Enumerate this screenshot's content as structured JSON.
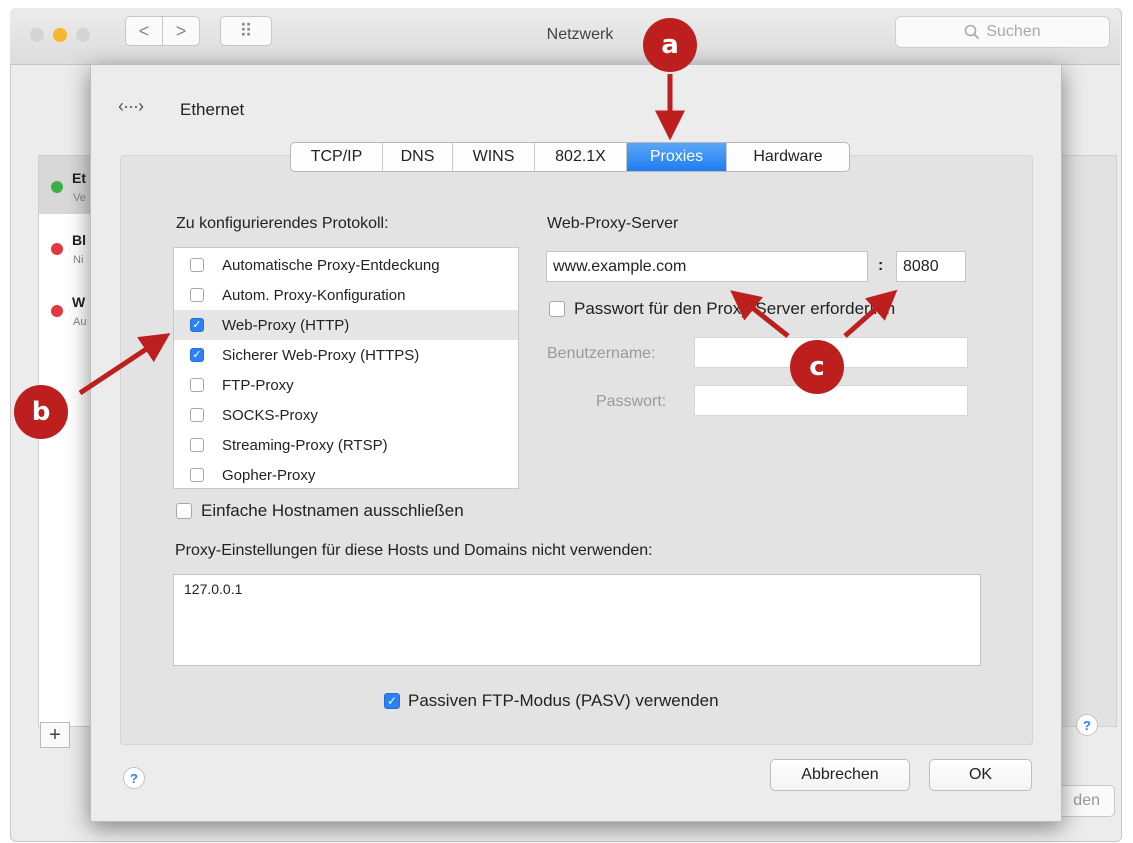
{
  "window": {
    "title": "Netzwerk",
    "search_placeholder": "Suchen",
    "back_glyph": "<",
    "forward_glyph": ">",
    "grid_glyph": "⠿",
    "traffic_lights": {
      "close": "#d4d4d4",
      "minimize": "#f5b82e",
      "zoom": "#d4d4d4"
    }
  },
  "background": {
    "services": [
      {
        "name": "Et",
        "sub": "Ve",
        "status_color": "#3cb043"
      },
      {
        "name": "Bl",
        "sub": "Ni",
        "status_color": "#e0393e"
      },
      {
        "name": "W",
        "sub": "Au",
        "status_color": "#e0393e"
      }
    ],
    "plus_label": "+",
    "help_label": "?",
    "right_button_fragment": "den"
  },
  "sheet": {
    "interface_icon": "‹···›",
    "interface_name": "Ethernet",
    "tabs": [
      {
        "label": "TCP/IP",
        "active": false
      },
      {
        "label": "DNS",
        "active": false
      },
      {
        "label": "WINS",
        "active": false
      },
      {
        "label": "802.1X",
        "active": false
      },
      {
        "label": "Proxies",
        "active": true
      },
      {
        "label": "Hardware",
        "active": false
      }
    ],
    "protocol_heading": "Zu konfigurierendes Protokoll:",
    "protocols": [
      {
        "label": "Automatische Proxy-Entdeckung",
        "checked": false,
        "selected": false
      },
      {
        "label": "Autom. Proxy-Konfiguration",
        "checked": false,
        "selected": false
      },
      {
        "label": "Web-Proxy (HTTP)",
        "checked": true,
        "selected": true
      },
      {
        "label": "Sicherer Web-Proxy (HTTPS)",
        "checked": true,
        "selected": false
      },
      {
        "label": "FTP-Proxy",
        "checked": false,
        "selected": false
      },
      {
        "label": "SOCKS-Proxy",
        "checked": false,
        "selected": false
      },
      {
        "label": "Streaming-Proxy (RTSP)",
        "checked": false,
        "selected": false
      },
      {
        "label": "Gopher-Proxy",
        "checked": false,
        "selected": false
      }
    ],
    "server_heading": "Web-Proxy-Server",
    "server_value": "www.example.com",
    "port_separator": ":",
    "port_value": "8080",
    "password_required_label": "Passwort für den Proxy-Server erforderlich",
    "password_required_checked": false,
    "username_label": "Benutzername:",
    "username_value": "",
    "password_label": "Passwort:",
    "password_value": "",
    "exclude_simple_label": "Einfache Hostnamen ausschließen",
    "exclude_simple_checked": false,
    "bypass_heading": "Proxy-Einstellungen für diese Hosts und Domains nicht verwenden:",
    "bypass_value": "127.0.0.1",
    "passive_ftp_label": "Passiven FTP-Modus (PASV) verwenden",
    "passive_ftp_checked": true,
    "help_label": "?",
    "cancel_label": "Abbrechen",
    "ok_label": "OK",
    "checkmark": "✓"
  },
  "annotations": {
    "badge_a": "a",
    "badge_b": "b",
    "badge_c": "c",
    "color": "#bd1e1e"
  }
}
